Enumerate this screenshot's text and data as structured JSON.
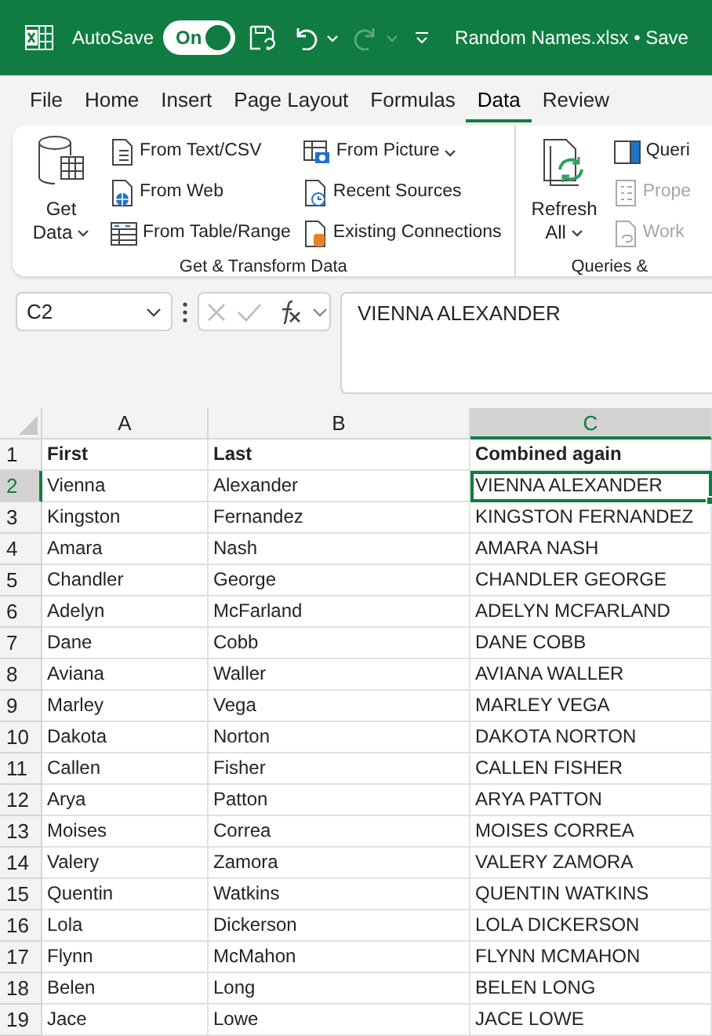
{
  "title_bar": {
    "autosave_label": "AutoSave",
    "autosave": {
      "on": true,
      "label": "On"
    },
    "redo": {
      "disabled": true
    },
    "document_title": "Random Names.xlsx • Save"
  },
  "tabs": [
    {
      "label": "File",
      "selected": false
    },
    {
      "label": "Home",
      "selected": false
    },
    {
      "label": "Insert",
      "selected": false
    },
    {
      "label": "Page Layout",
      "selected": false
    },
    {
      "label": "Formulas",
      "selected": false
    },
    {
      "label": "Data",
      "selected": true
    },
    {
      "label": "Review",
      "selected": false
    }
  ],
  "ribbon": {
    "groups": [
      {
        "label": "Get & Transform Data",
        "buttons": [
          {
            "kind": "large",
            "label": "Get Data",
            "dropdown": true,
            "disabled": false
          },
          {
            "kind": "small",
            "label": "From Text/CSV",
            "dropdown": false,
            "disabled": false
          },
          {
            "kind": "small",
            "label": "From Web",
            "dropdown": false,
            "disabled": false
          },
          {
            "kind": "small",
            "label": "From Table/Range",
            "dropdown": false,
            "disabled": false
          },
          {
            "kind": "small",
            "label": "From Picture",
            "dropdown": true,
            "disabled": false
          },
          {
            "kind": "small",
            "label": "Recent Sources",
            "dropdown": false,
            "disabled": false
          },
          {
            "kind": "small",
            "label": "Existing Connections",
            "dropdown": false,
            "disabled": false
          }
        ]
      },
      {
        "label": "Queries &",
        "buttons": [
          {
            "kind": "large",
            "label": "Refresh All",
            "dropdown": true,
            "disabled": false
          },
          {
            "kind": "small",
            "label": "Queri",
            "dropdown": false,
            "disabled": false
          },
          {
            "kind": "small",
            "label": "Prope",
            "dropdown": false,
            "disabled": true
          },
          {
            "kind": "small",
            "label": "Work",
            "dropdown": false,
            "disabled": true
          }
        ]
      }
    ]
  },
  "formula_bar": {
    "name_box": "C2",
    "formula": "VIENNA ALEXANDER"
  },
  "sheet": {
    "columns": [
      {
        "label": "A",
        "selected": false
      },
      {
        "label": "B",
        "selected": false
      },
      {
        "label": "C",
        "selected": true
      }
    ],
    "rows": [
      {
        "number": "1",
        "kind": "header",
        "selected": false,
        "cells": [
          "First",
          "Last",
          "Combined again"
        ]
      },
      {
        "number": "2",
        "kind": "data",
        "selected": true,
        "cells": [
          "Vienna",
          "Alexander",
          "VIENNA ALEXANDER"
        ]
      },
      {
        "number": "3",
        "kind": "data",
        "selected": false,
        "cells": [
          "Kingston",
          "Fernandez",
          "KINGSTON FERNANDEZ"
        ]
      },
      {
        "number": "4",
        "kind": "data",
        "selected": false,
        "cells": [
          "Amara",
          "Nash",
          "AMARA NASH"
        ]
      },
      {
        "number": "5",
        "kind": "data",
        "selected": false,
        "cells": [
          "Chandler",
          "George",
          "CHANDLER GEORGE"
        ]
      },
      {
        "number": "6",
        "kind": "data",
        "selected": false,
        "cells": [
          "Adelyn",
          "McFarland",
          "ADELYN MCFARLAND"
        ]
      },
      {
        "number": "7",
        "kind": "data",
        "selected": false,
        "cells": [
          "Dane",
          "Cobb",
          "DANE COBB"
        ]
      },
      {
        "number": "8",
        "kind": "data",
        "selected": false,
        "cells": [
          "Aviana",
          "Waller",
          "AVIANA WALLER"
        ]
      },
      {
        "number": "9",
        "kind": "data",
        "selected": false,
        "cells": [
          "Marley",
          "Vega",
          "MARLEY VEGA"
        ]
      },
      {
        "number": "10",
        "kind": "data",
        "selected": false,
        "cells": [
          "Dakota",
          "Norton",
          "DAKOTA NORTON"
        ]
      },
      {
        "number": "11",
        "kind": "data",
        "selected": false,
        "cells": [
          "Callen",
          "Fisher",
          "CALLEN FISHER"
        ]
      },
      {
        "number": "12",
        "kind": "data",
        "selected": false,
        "cells": [
          "Arya",
          "Patton",
          "ARYA PATTON"
        ]
      },
      {
        "number": "13",
        "kind": "data",
        "selected": false,
        "cells": [
          "Moises",
          "Correa",
          "MOISES CORREA"
        ]
      },
      {
        "number": "14",
        "kind": "data",
        "selected": false,
        "cells": [
          "Valery",
          "Zamora",
          "VALERY ZAMORA"
        ]
      },
      {
        "number": "15",
        "kind": "data",
        "selected": false,
        "cells": [
          "Quentin",
          "Watkins",
          "QUENTIN WATKINS"
        ]
      },
      {
        "number": "16",
        "kind": "data",
        "selected": false,
        "cells": [
          "Lola",
          "Dickerson",
          "LOLA DICKERSON"
        ]
      },
      {
        "number": "17",
        "kind": "data",
        "selected": false,
        "cells": [
          "Flynn",
          "McMahon",
          "FLYNN MCMAHON"
        ]
      },
      {
        "number": "18",
        "kind": "data",
        "selected": false,
        "cells": [
          "Belen",
          "Long",
          "BELEN LONG"
        ]
      },
      {
        "number": "19",
        "kind": "data",
        "selected": false,
        "cells": [
          "Jace",
          "Lowe",
          "JACE LOWE"
        ]
      }
    ]
  }
}
